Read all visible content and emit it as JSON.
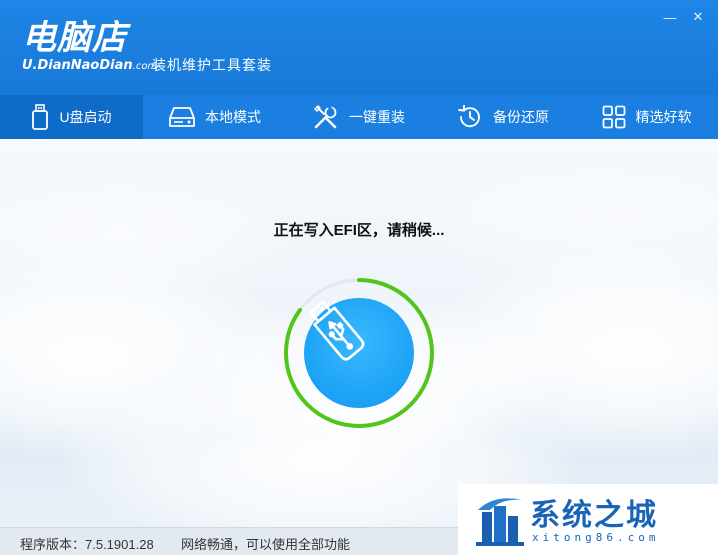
{
  "header": {
    "brand_title": "电脑店",
    "brand_url_main": "U.DianNaoDian",
    "brand_url_tld": ".com",
    "brand_subtitle": "装机维护工具套装",
    "minimize_glyph": "—",
    "close_glyph": "✕"
  },
  "nav": {
    "items": [
      {
        "label": "U盘启动",
        "icon": "usb-drive-icon",
        "active": true
      },
      {
        "label": "本地模式",
        "icon": "hard-disk-icon",
        "active": false
      },
      {
        "label": "一键重装",
        "icon": "tools-icon",
        "active": false
      },
      {
        "label": "备份还原",
        "icon": "history-icon",
        "active": false
      },
      {
        "label": "精选好软",
        "icon": "apps-grid-icon",
        "active": false
      }
    ]
  },
  "main": {
    "status_text": "正在写入EFI区，请稍候...",
    "progress_fraction": 0.85,
    "center_icon": "usb-icon"
  },
  "footer": {
    "version": "程序版本：7.5.1901.28",
    "network": "网络畅通，可以使用全部功能"
  },
  "watermark": {
    "text": "系统之城",
    "sub": "xitong86.com"
  },
  "colors": {
    "header_blue": "#1e86e6",
    "nav_blue": "#1a7fe1",
    "nav_active": "#0f6bc8",
    "progress_green": "#52c41a",
    "usb_blue": "#1fa5f6"
  }
}
